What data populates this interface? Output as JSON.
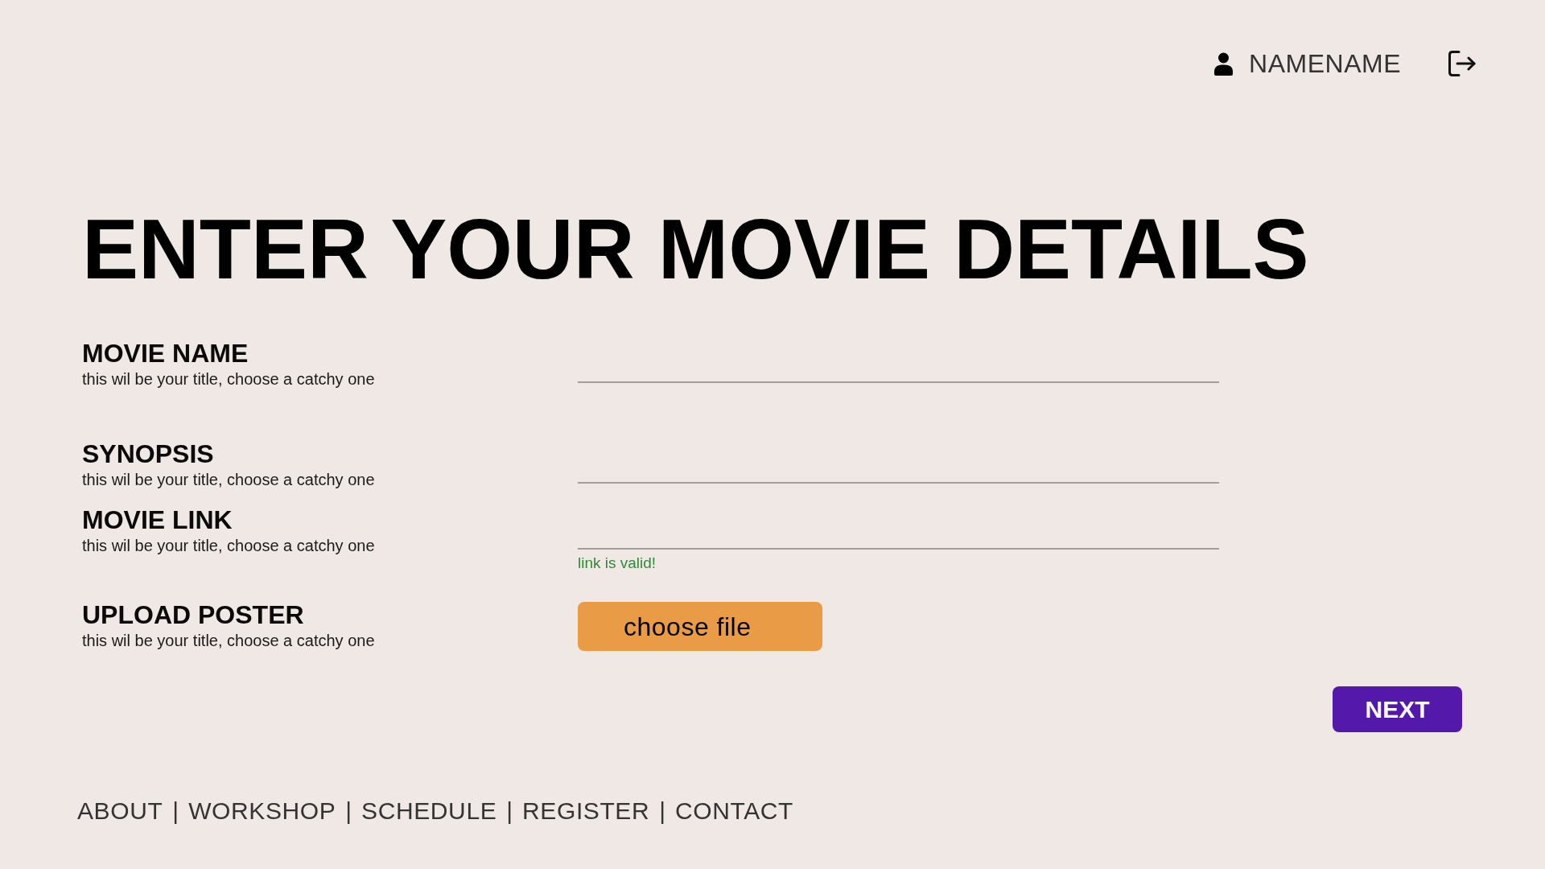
{
  "header": {
    "user": {
      "name": "NAMENAME"
    }
  },
  "title": "ENTER YOUR MOVIE DETAILS",
  "form": {
    "fields": [
      {
        "kind": "text",
        "label": "MOVIE NAME",
        "hint": "this wil be your title, choose a catchy one"
      },
      {
        "kind": "text",
        "label": "SYNOPSIS",
        "hint": "this wil be your title, choose a catchy one"
      },
      {
        "kind": "text",
        "label": "MOVIE LINK",
        "hint": "this wil be your title, choose a catchy one",
        "message": {
          "text": "link is valid!",
          "valid": true
        }
      },
      {
        "kind": "file",
        "label": "UPLOAD POSTER",
        "hint": "this wil be your title, choose a catchy one",
        "button": "choose file"
      }
    ]
  },
  "next_button": "NEXT",
  "footer": {
    "items": [
      {
        "kind": "link",
        "text": "ABOUT"
      },
      {
        "kind": "separator",
        "text": "|"
      },
      {
        "kind": "link",
        "text": "WORKSHOP"
      },
      {
        "kind": "separator",
        "text": "|"
      },
      {
        "kind": "link",
        "text": "SCHEDULE"
      },
      {
        "kind": "separator",
        "text": "|"
      },
      {
        "kind": "link",
        "text": "REGISTER"
      },
      {
        "kind": "separator",
        "text": "|"
      },
      {
        "kind": "link",
        "text": "CONTACT"
      }
    ]
  }
}
